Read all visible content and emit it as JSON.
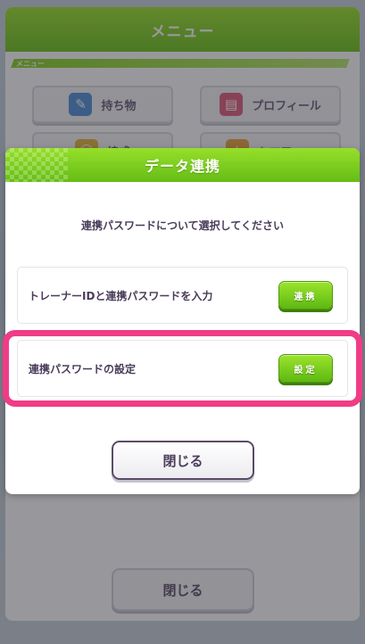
{
  "background": {
    "menu_title": "メニュー",
    "section_label": "メニュー",
    "tiles": [
      {
        "label": "持ち物",
        "icon": "scroll-icon"
      },
      {
        "label": "プロフィール",
        "icon": "profile-card-icon"
      },
      {
        "label": "編成",
        "icon": "people-icon"
      },
      {
        "label": "トロフィー",
        "icon": "trophy-icon"
      }
    ],
    "close_label": "閉じる"
  },
  "dialog": {
    "title": "データ連携",
    "prompt": "連携パスワードについて選択してください",
    "options": [
      {
        "label": "トレーナーIDと連携パスワードを入力",
        "button": "連携"
      },
      {
        "label": "連携パスワードの設定",
        "button": "設定"
      }
    ],
    "close_label": "閉じる"
  },
  "colors": {
    "accent_green": "#6cc21a",
    "highlight_pink": "#f03c86",
    "text_dark": "#4a3c5a"
  }
}
